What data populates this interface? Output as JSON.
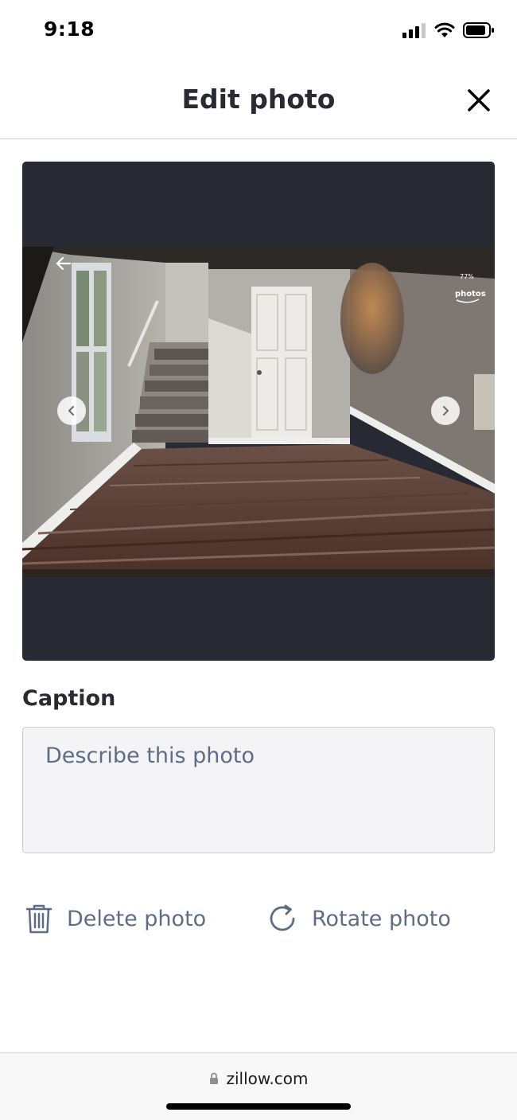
{
  "status_bar": {
    "time": "9:18"
  },
  "header": {
    "title": "Edit photo"
  },
  "photo": {
    "overlay_battery": "77%",
    "overlay_app_label": "photos"
  },
  "caption": {
    "label": "Caption",
    "placeholder": "Describe this photo",
    "value": ""
  },
  "actions": {
    "delete_label": "Delete photo",
    "rotate_label": "Rotate photo"
  },
  "browser": {
    "url": "zillow.com"
  },
  "colors": {
    "text_primary": "#2a2a33",
    "text_secondary": "#5e6c85",
    "photo_background": "#272a33",
    "input_background": "#f4f4f7"
  }
}
